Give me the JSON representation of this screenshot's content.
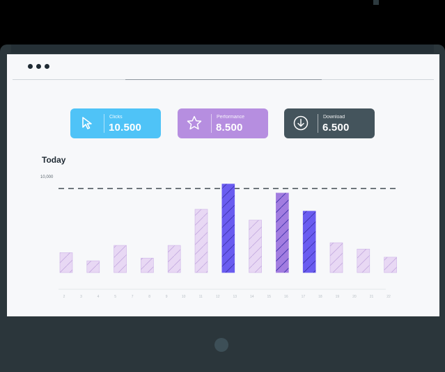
{
  "cards": [
    {
      "label": "Clicks",
      "value": "10.500",
      "icon": "cursor-icon",
      "color": "#4fc3f7"
    },
    {
      "label": "Performance",
      "value": "8.500",
      "icon": "star-icon",
      "color": "#b68ee0"
    },
    {
      "label": "Download",
      "value": "6.500",
      "icon": "download-icon",
      "color": "#44545c"
    }
  ],
  "chart": {
    "title": "Today"
  },
  "chart_data": {
    "type": "bar",
    "title": "Today",
    "y_top_label": "10,000",
    "ylim": [
      0,
      10000
    ],
    "grid": false,
    "categories": [
      "2",
      "3",
      "4",
      "5",
      "7",
      "8",
      "9",
      "10",
      "11",
      "12",
      "13",
      "14",
      "15",
      "16",
      "17",
      "18",
      "19",
      "20",
      "21",
      "22"
    ],
    "values": [
      2200,
      1300,
      3000,
      1600,
      3000,
      7000,
      9800,
      5800,
      8800,
      6800,
      3300,
      2600,
      1700
    ],
    "bar_colors": [
      "#e8d8f4",
      "#e8d8f4",
      "#e8d8f4",
      "#e8d8f4",
      "#e8d8f4",
      "#e8d8f4",
      "#6a5cf0",
      "#e8d8f4",
      "#a27ce0",
      "#6a5cf0",
      "#e8d8f4",
      "#e8d8f4",
      "#e8d8f4"
    ],
    "reference_line": 9300
  }
}
